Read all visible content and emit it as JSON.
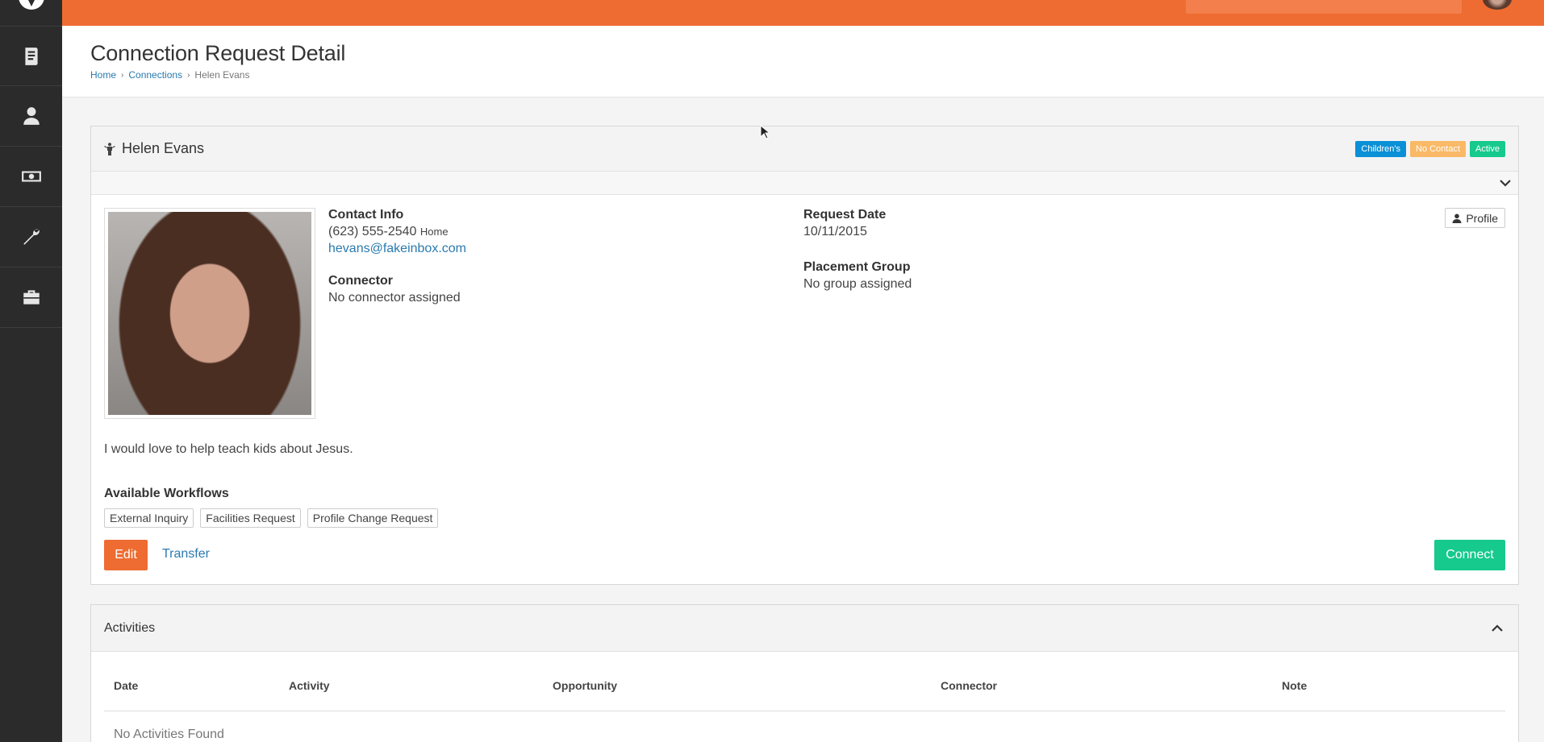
{
  "colors": {
    "accent": "#ee6c31",
    "success": "#16c98d",
    "info": "#0a90d6",
    "warning": "#f9b966",
    "active": "#16c98d",
    "sidebar": "#2b2b2b"
  },
  "sidebar": {
    "logo_icon": "rock-logo-icon",
    "items": [
      {
        "icon": "book-icon"
      },
      {
        "icon": "user-icon"
      },
      {
        "icon": "money-icon"
      },
      {
        "icon": "wrench-icon"
      },
      {
        "icon": "briefcase-icon"
      }
    ]
  },
  "header": {
    "title": "Connection Request Detail",
    "breadcrumb": [
      "Home",
      "Connections",
      "Helen Evans"
    ]
  },
  "request": {
    "name": "Helen Evans",
    "labels": [
      {
        "text": "Children's",
        "color": "#0a90d6"
      },
      {
        "text": "No Contact",
        "color": "#f9b966"
      },
      {
        "text": "Active",
        "color": "#16c98d"
      }
    ],
    "contact_info_label": "Contact Info",
    "phone": "(623) 555-2540",
    "phone_type": "Home",
    "email": "hevans@fakeinbox.com",
    "connector_label": "Connector",
    "connector_value": "No connector assigned",
    "request_date_label": "Request Date",
    "request_date": "10/11/2015",
    "placement_group_label": "Placement Group",
    "placement_group_value": "No group assigned",
    "profile_button": "Profile",
    "comment": "I would love to help teach kids about Jesus.",
    "workflows_label": "Available Workflows",
    "workflows": [
      "External Inquiry",
      "Facilities Request",
      "Profile Change Request"
    ],
    "edit_button": "Edit",
    "transfer_link": "Transfer",
    "connect_button": "Connect"
  },
  "activities": {
    "title": "Activities",
    "columns": [
      "Date",
      "Activity",
      "Opportunity",
      "Connector",
      "Note"
    ],
    "empty_text": "No Activities Found"
  }
}
